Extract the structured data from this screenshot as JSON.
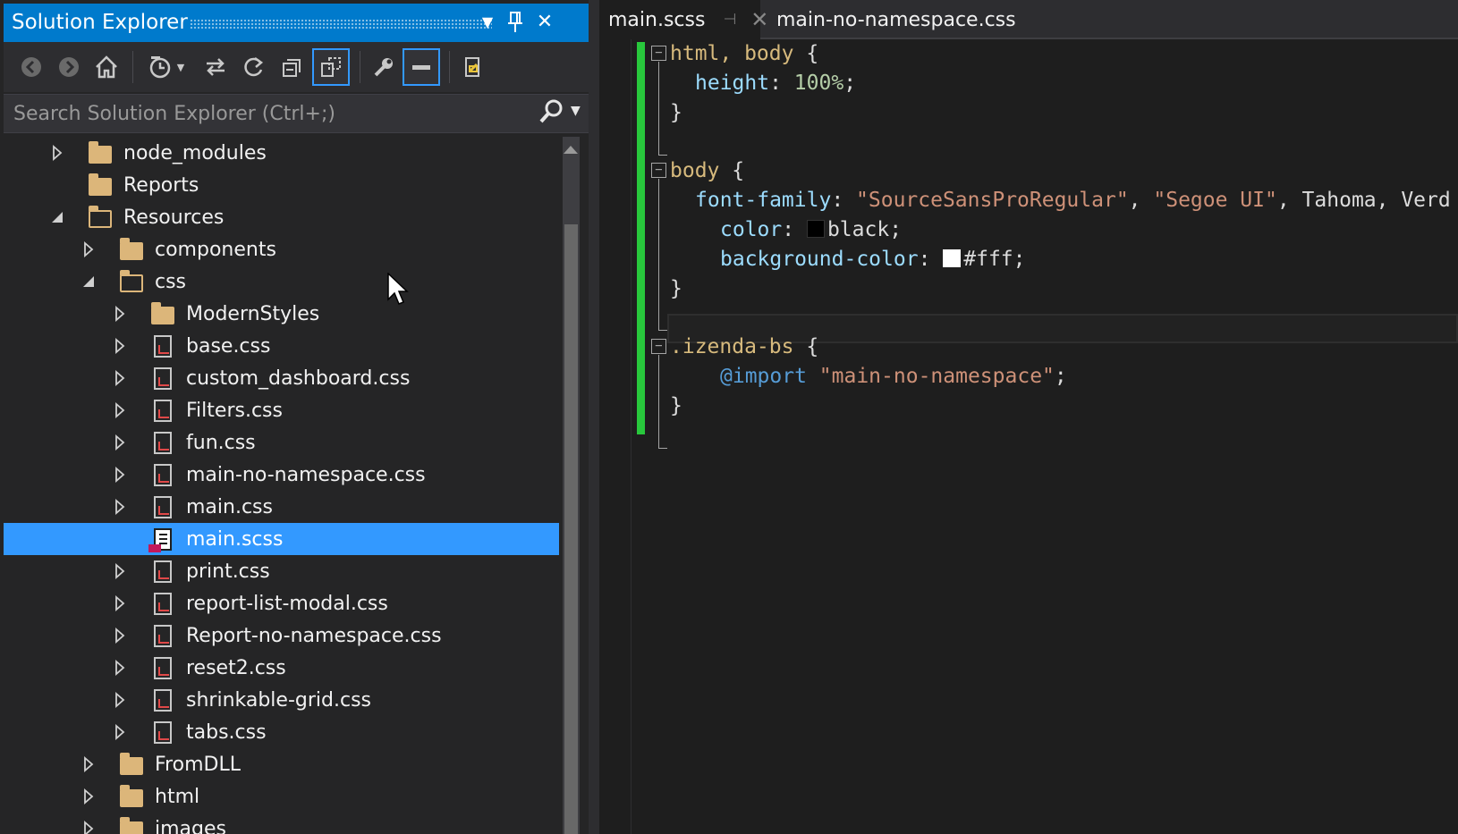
{
  "solution_explorer": {
    "title": "Solution Explorer",
    "search_placeholder": "Search Solution Explorer (Ctrl+;)",
    "tree": [
      {
        "label": "node_modules",
        "type": "folder",
        "level": 0,
        "expander": "collapsed"
      },
      {
        "label": "Reports",
        "type": "folder",
        "level": 0,
        "expander": "none"
      },
      {
        "label": "Resources",
        "type": "folder-open",
        "level": 0,
        "expander": "expanded"
      },
      {
        "label": "components",
        "type": "folder",
        "level": 1,
        "expander": "collapsed"
      },
      {
        "label": "css",
        "type": "folder-open",
        "level": 1,
        "expander": "expanded"
      },
      {
        "label": "ModernStyles",
        "type": "folder",
        "level": 2,
        "expander": "collapsed"
      },
      {
        "label": "base.css",
        "type": "css",
        "level": 2,
        "expander": "collapsed"
      },
      {
        "label": "custom_dashboard.css",
        "type": "css",
        "level": 2,
        "expander": "collapsed"
      },
      {
        "label": "Filters.css",
        "type": "css",
        "level": 2,
        "expander": "collapsed"
      },
      {
        "label": "fun.css",
        "type": "css",
        "level": 2,
        "expander": "collapsed"
      },
      {
        "label": "main-no-namespace.css",
        "type": "css",
        "level": 2,
        "expander": "collapsed"
      },
      {
        "label": "main.css",
        "type": "css",
        "level": 2,
        "expander": "collapsed"
      },
      {
        "label": "main.scss",
        "type": "scss",
        "level": 2,
        "expander": "none",
        "selected": true
      },
      {
        "label": "print.css",
        "type": "css",
        "level": 2,
        "expander": "collapsed"
      },
      {
        "label": "report-list-modal.css",
        "type": "css",
        "level": 2,
        "expander": "collapsed"
      },
      {
        "label": "Report-no-namespace.css",
        "type": "css",
        "level": 2,
        "expander": "collapsed"
      },
      {
        "label": "reset2.css",
        "type": "css",
        "level": 2,
        "expander": "collapsed"
      },
      {
        "label": "shrinkable-grid.css",
        "type": "css",
        "level": 2,
        "expander": "collapsed"
      },
      {
        "label": "tabs.css",
        "type": "css",
        "level": 2,
        "expander": "collapsed"
      },
      {
        "label": "FromDLL",
        "type": "folder",
        "level": 1,
        "expander": "collapsed"
      },
      {
        "label": "html",
        "type": "folder",
        "level": 1,
        "expander": "collapsed"
      },
      {
        "label": "images",
        "type": "folder",
        "level": 1,
        "expander": "collapsed"
      }
    ]
  },
  "tabs": [
    {
      "label": "main.scss",
      "active": true
    },
    {
      "label": "main-no-namespace.css",
      "active": false
    }
  ],
  "code": {
    "l1_sel": "html, body",
    "l1_brace": " {",
    "l2_prop": "height",
    "l2_colon": ": ",
    "l2_val": "100%",
    "l2_end": ";",
    "l3": "}",
    "l5_sel": "body",
    "l5_brace": " {",
    "l6_prop": "font-family",
    "l6_colon": ": ",
    "l6_s1": "\"SourceSansProRegular\"",
    "l6_c1": ", ",
    "l6_s2": "\"Segoe UI\"",
    "l6_rest": ", Tahoma, Verd",
    "l7_prop": "color",
    "l7_colon": ": ",
    "l7_val": "black;",
    "l8_prop": "background-color",
    "l8_colon": ": ",
    "l8_val": "#fff;",
    "l9": "}",
    "l11_sel": ".izenda-bs",
    "l11_brace": " {",
    "l12_at": "@import",
    "l12_sp": " ",
    "l12_str": "\"main-no-namespace\"",
    "l12_end": ";",
    "l13": "}"
  },
  "colors": {
    "accent": "#007acc",
    "selection": "#3399ff",
    "change_bar": "#28c83c",
    "swatch_black": "#000000",
    "swatch_white": "#ffffff"
  }
}
